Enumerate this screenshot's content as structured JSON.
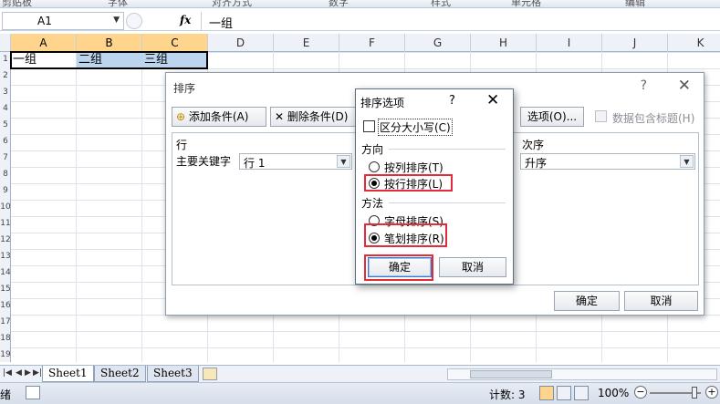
{
  "ribbon": {
    "groups": [
      "剪贴板",
      "字体",
      "对齐方式",
      "数字",
      "样式",
      "单元格",
      "编辑"
    ]
  },
  "formula_bar": {
    "cell_ref": "A1",
    "fx": "fx",
    "content": "一组"
  },
  "grid": {
    "columns": [
      "A",
      "B",
      "C",
      "D",
      "E",
      "F",
      "G",
      "H",
      "I",
      "J",
      "K"
    ],
    "row_numbers": [
      "1",
      "2",
      "3",
      "4",
      "5",
      "6",
      "7",
      "8",
      "9",
      "10",
      "11",
      "12",
      "13",
      "14",
      "15",
      "16",
      "17",
      "18",
      "19"
    ],
    "cells": [
      "一组",
      "二组",
      "三组"
    ]
  },
  "sheet_tabs": [
    "Sheet1",
    "Sheet2",
    "Sheet3"
  ],
  "status": {
    "ready": "绪",
    "count": "计数: 3",
    "zoom": "100%"
  },
  "sort_dialog": {
    "title": "排序",
    "help": "?",
    "add_condition": "添加条件(A)",
    "delete_condition": "删除条件(D)",
    "options": "选项(O)...",
    "header_checkbox": "数据包含标题(H)",
    "col_row": "行",
    "col_order": "次序",
    "primary_key_label": "主要关键字",
    "primary_key_value": "行 1",
    "order_value": "升序",
    "ok": "确定",
    "cancel": "取消"
  },
  "options_dialog": {
    "title": "排序选项",
    "help": "?",
    "case_sensitive": "区分大小写(C)",
    "direction_label": "方向",
    "by_column": "按列排序(T)",
    "by_row": "按行排序(L)",
    "method_label": "方法",
    "alphabetical": "字母排序(S)",
    "stroke": "笔划排序(R)",
    "ok": "确定",
    "cancel": "取消"
  },
  "colors": {
    "highlight": "#e32b3a",
    "selection": "#bcd4ee",
    "header_selected": "#ffd58d"
  }
}
